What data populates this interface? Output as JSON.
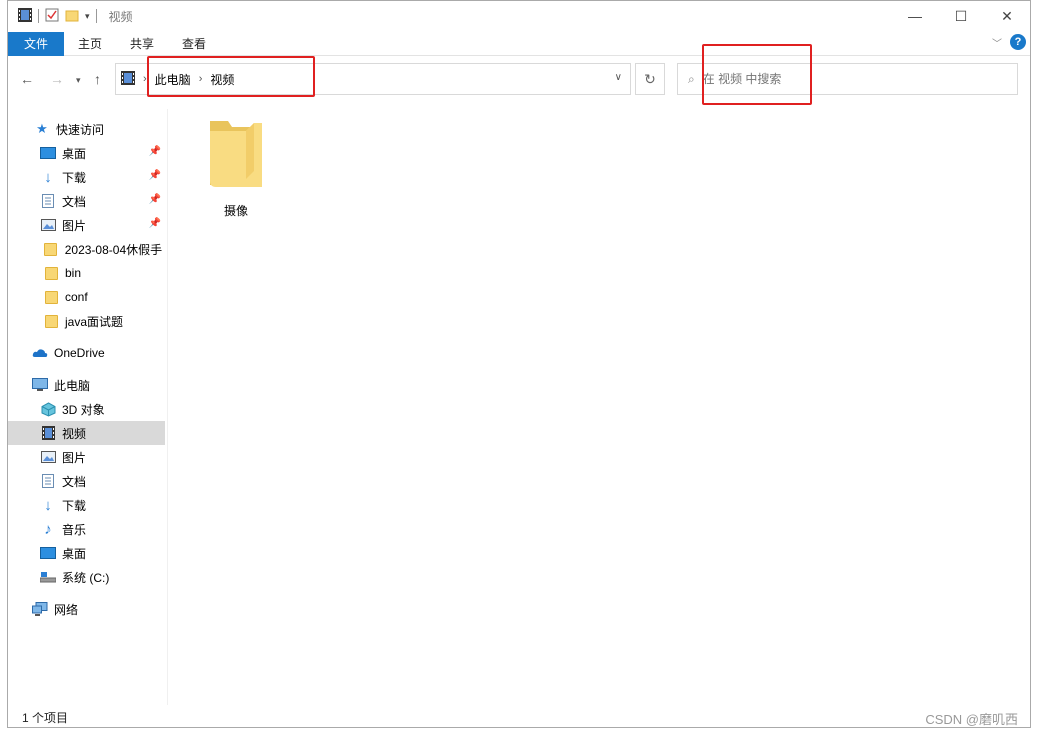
{
  "window": {
    "title": "视频",
    "controls": {
      "minimize": "—",
      "maximize": "☐",
      "close": "✕"
    }
  },
  "ribbon": {
    "tabs": [
      "文件",
      "主页",
      "共享",
      "查看"
    ],
    "help": "?"
  },
  "address": {
    "segments": [
      "此电脑",
      "视频"
    ],
    "search_placeholder": "在 视频 中搜索"
  },
  "sidebar": {
    "quick_access": "快速访问",
    "quick_items": [
      "桌面",
      "下载",
      "文档",
      "图片",
      "2023-08-04休假手",
      "bin",
      "conf",
      "java面试题"
    ],
    "onedrive": "OneDrive",
    "this_pc": "此电脑",
    "pc_items": [
      "3D 对象",
      "视频",
      "图片",
      "文档",
      "下载",
      "音乐",
      "桌面",
      "系统 (C:)"
    ],
    "network": "网络"
  },
  "content": {
    "folders": [
      {
        "name": "摄像"
      }
    ]
  },
  "status": {
    "count": "1 个项目"
  },
  "watermark": "CSDN @磨叽西"
}
